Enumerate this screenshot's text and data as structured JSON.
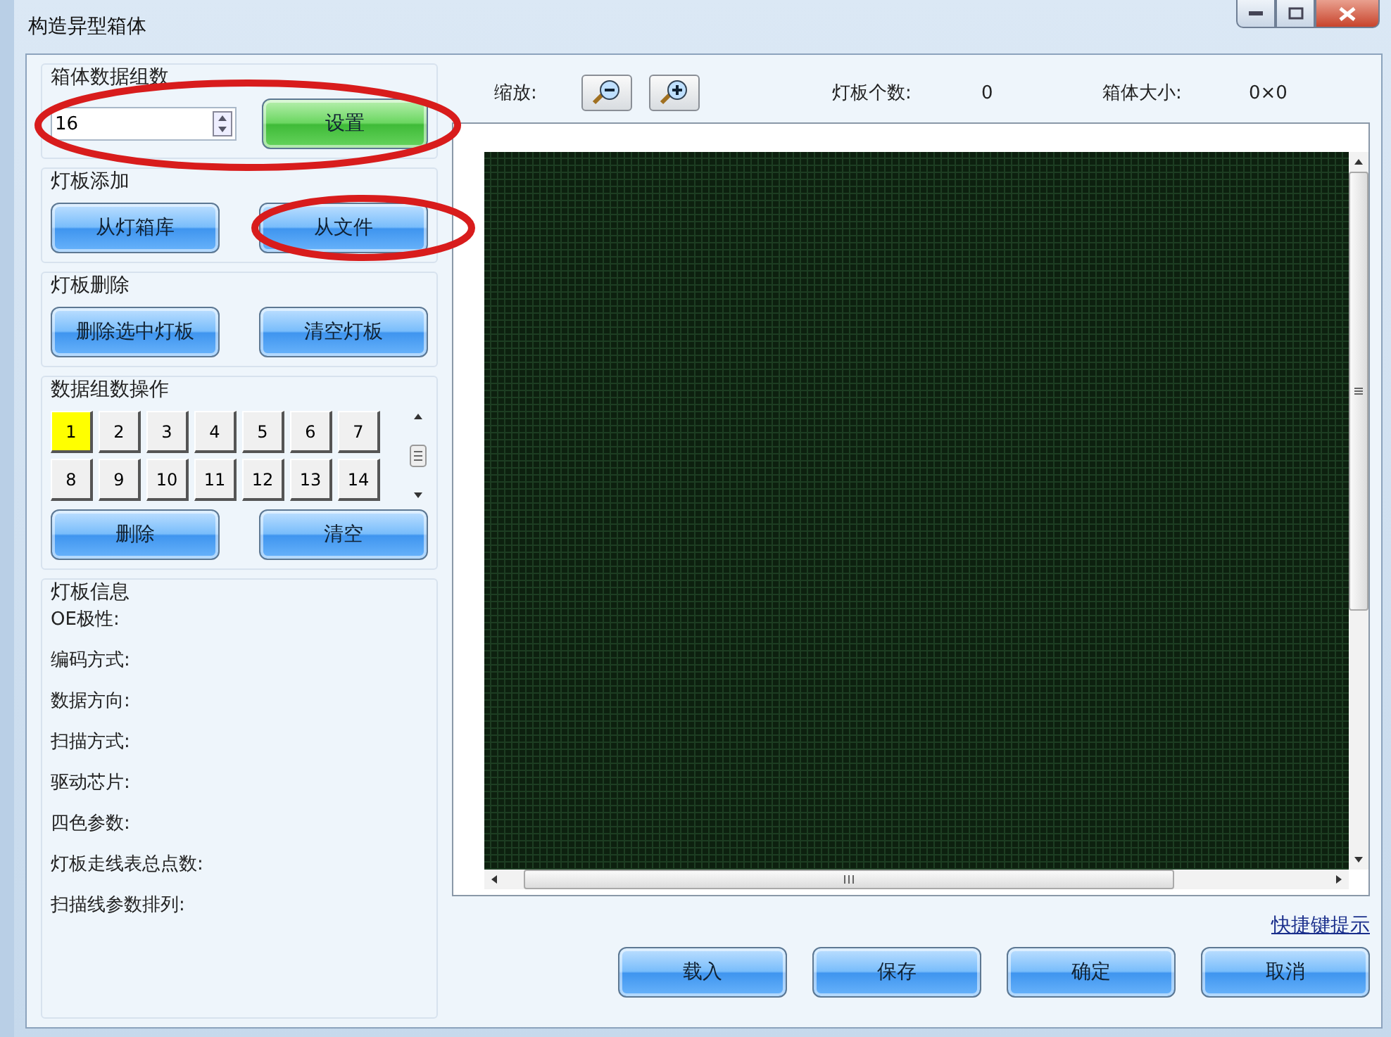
{
  "window": {
    "title": "构造异型箱体"
  },
  "data_groups": {
    "title": "箱体数据组数",
    "value": "16",
    "set_button": "设置",
    "circled": true
  },
  "panel_add": {
    "title": "灯板添加",
    "buttons": [
      {
        "label": "从灯箱库",
        "circled": false
      },
      {
        "label": "从文件",
        "circled": true
      }
    ]
  },
  "panel_delete": {
    "title": "灯板删除",
    "buttons": [
      "删除选中灯板",
      "清空灯板"
    ]
  },
  "group_ops": {
    "title": "数据组数操作",
    "numbers": [
      {
        "label": "1",
        "selected": true
      },
      {
        "label": "2",
        "selected": false
      },
      {
        "label": "3",
        "selected": false
      },
      {
        "label": "4",
        "selected": false
      },
      {
        "label": "5",
        "selected": false
      },
      {
        "label": "6",
        "selected": false
      },
      {
        "label": "7",
        "selected": false
      },
      {
        "label": "8",
        "selected": false
      },
      {
        "label": "9",
        "selected": false
      },
      {
        "label": "10",
        "selected": false
      },
      {
        "label": "11",
        "selected": false
      },
      {
        "label": "12",
        "selected": false
      },
      {
        "label": "13",
        "selected": false
      },
      {
        "label": "14",
        "selected": false
      }
    ],
    "buttons": [
      "删除",
      "清空"
    ]
  },
  "panel_info": {
    "title": "灯板信息",
    "fields": [
      "OE极性:",
      "编码方式:",
      "数据方向:",
      "扫描方式:",
      "驱动芯片:",
      "四色参数:",
      "灯板走线表总点数:",
      "扫描线参数排列:"
    ]
  },
  "toolbar": {
    "zoom_label": "缩放:",
    "panel_count_label": "灯板个数:",
    "panel_count": "0",
    "box_size_label": "箱体大小:",
    "box_size": "0×0"
  },
  "shortcut_link": "快捷键提示",
  "footer_buttons": [
    "载入",
    "保存",
    "确定",
    "取消"
  ]
}
